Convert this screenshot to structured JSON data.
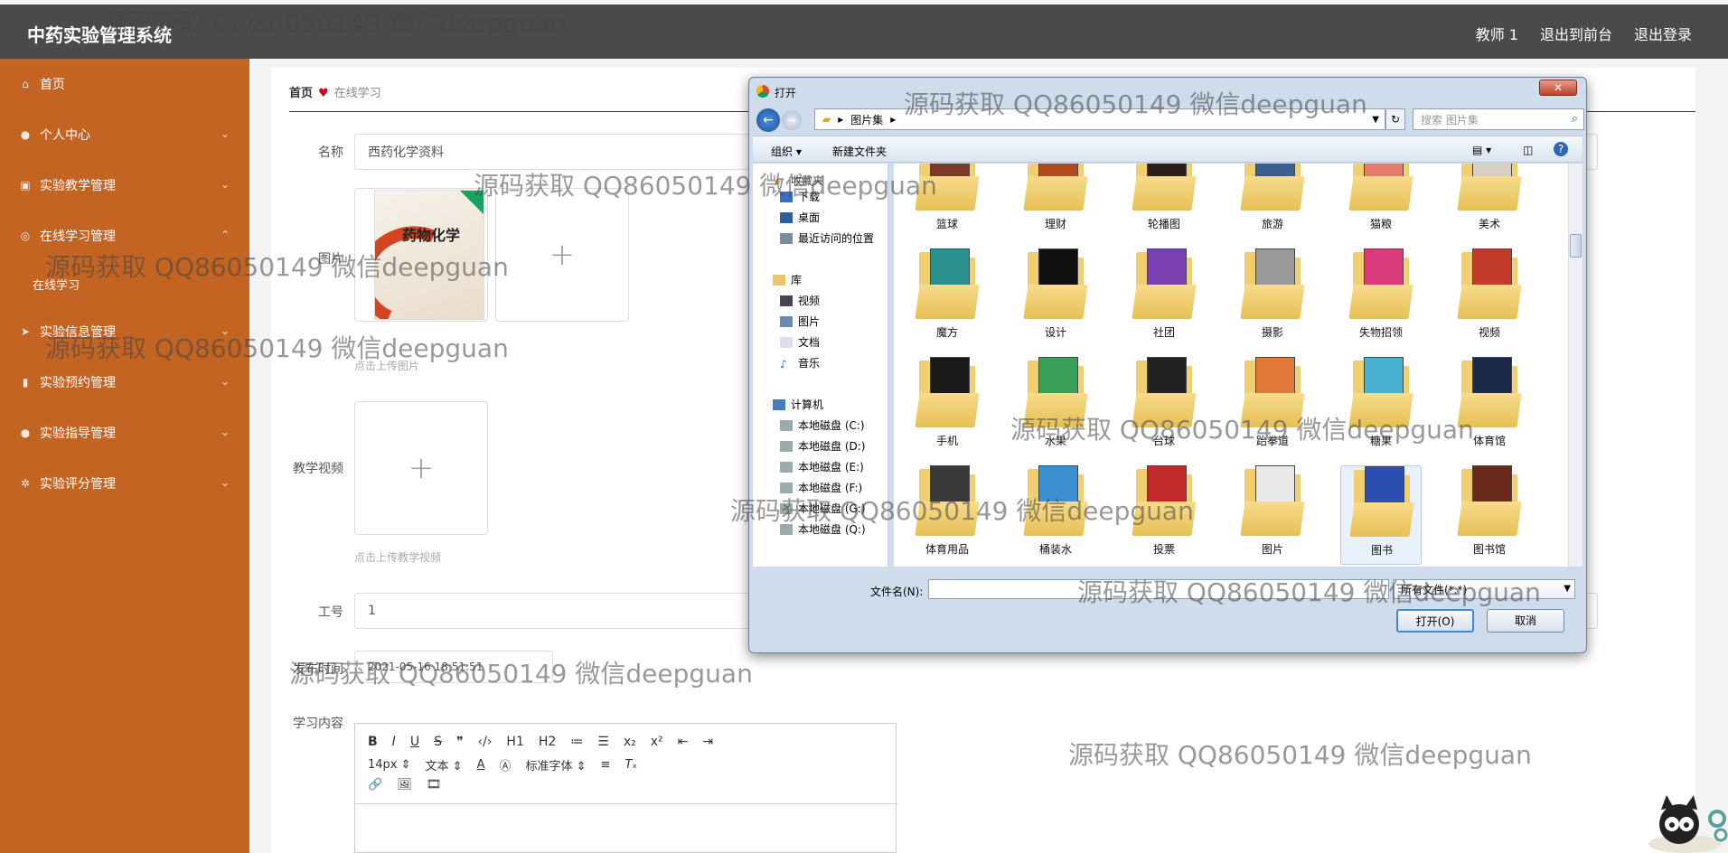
{
  "topbar": {
    "brand": "中药实验管理系统",
    "user": "教师 1",
    "to_frontend": "退出到前台",
    "logout": "退出登录"
  },
  "sidebar": {
    "items": [
      {
        "label": "首页",
        "icon": "home-icon"
      },
      {
        "label": "个人中心",
        "icon": "person-icon"
      },
      {
        "label": "实验教学管理",
        "icon": "clipboard-icon"
      },
      {
        "label": "在线学习管理",
        "icon": "globe-icon"
      },
      {
        "label": "实验信息管理",
        "icon": "send-icon"
      },
      {
        "label": "实验预约管理",
        "icon": "bar-chart-icon"
      },
      {
        "label": "实验指导管理",
        "icon": "person-icon"
      },
      {
        "label": "实验评分管理",
        "icon": "settings-icon"
      }
    ],
    "sub_item": "在线学习"
  },
  "breadcrumb": {
    "home": "首页",
    "current": "在线学习"
  },
  "form": {
    "name_label": "名称",
    "name_value": "西药化学资料",
    "image_label": "图片",
    "image_hint": "点击上传图片",
    "book_title": "药物化学",
    "video_label": "教学视频",
    "video_hint": "点击上传教学视频",
    "job_label": "工号",
    "job_value": "1",
    "time_label": "发布时间",
    "time_value": "2021-05-16 18:51:51",
    "content_label": "学习内容"
  },
  "editor": {
    "row1": [
      "B",
      "I",
      "U",
      "S",
      "❞",
      "‹/›",
      "H1",
      "H2",
      "≔",
      "☰",
      "x₂",
      "x²",
      "⇤",
      "⇥"
    ],
    "font_size": "14px",
    "text_style": "文本",
    "font_family": "标准字体",
    "row3": [
      "🔗",
      "🖼",
      "🎞"
    ]
  },
  "dialog": {
    "title": "打开",
    "close": "✕",
    "path": "图片集",
    "search_placeholder": "搜索 图片集",
    "organize": "组织 ▾",
    "new_folder": "新建文件夹",
    "nav_favorites": "收藏夹",
    "nav": [
      {
        "label": "下载"
      },
      {
        "label": "桌面"
      },
      {
        "label": "最近访问的位置"
      },
      {
        "label": "库"
      },
      {
        "label": "视频"
      },
      {
        "label": "图片"
      },
      {
        "label": "文档"
      },
      {
        "label": "音乐"
      },
      {
        "label": "计算机"
      },
      {
        "label": "本地磁盘 (C:)"
      },
      {
        "label": "本地磁盘 (D:)"
      },
      {
        "label": "本地磁盘 (E:)"
      },
      {
        "label": "本地磁盘 (F:)"
      },
      {
        "label": "本地磁盘 (G:)"
      },
      {
        "label": "本地磁盘 (Q:)"
      }
    ],
    "folders": [
      {
        "name": "篮球",
        "color": "#7a3b2a"
      },
      {
        "name": "理财",
        "color": "#b04a20"
      },
      {
        "name": "轮播图",
        "color": "#2a2018"
      },
      {
        "name": "旅游",
        "color": "#3a5f8f"
      },
      {
        "name": "猫粮",
        "color": "#e87a6a"
      },
      {
        "name": "美术",
        "color": "#d8d0c4"
      },
      {
        "name": "魔方",
        "color": "#2a8f8f"
      },
      {
        "name": "设计",
        "color": "#111111"
      },
      {
        "name": "社团",
        "color": "#7a3fb0"
      },
      {
        "name": "摄影",
        "color": "#9a9a9a"
      },
      {
        "name": "失物招领",
        "color": "#d83a7a"
      },
      {
        "name": "视频",
        "color": "#c23a2a"
      },
      {
        "name": "手机",
        "color": "#1a1a1a"
      },
      {
        "name": "水果",
        "color": "#3aa05a"
      },
      {
        "name": "台球",
        "color": "#222222"
      },
      {
        "name": "跆拳道",
        "color": "#e0783a"
      },
      {
        "name": "糖果",
        "color": "#4ab0d0"
      },
      {
        "name": "体育馆",
        "color": "#1a2a4a"
      },
      {
        "name": "体育用品",
        "color": "#3a3a3a"
      },
      {
        "name": "桶装水",
        "color": "#3a8fd0"
      },
      {
        "name": "投票",
        "color": "#c02a2a"
      },
      {
        "name": "图片",
        "color": "#e8e8e8"
      },
      {
        "name": "图书",
        "color": "#2a4fb0"
      },
      {
        "name": "图书馆",
        "color": "#6a2a1a"
      }
    ],
    "filename_label": "文件名(N):",
    "filetype": "所有文件(*.*)",
    "open_button": "打开(O)",
    "cancel_button": "取消"
  },
  "watermark": "源码获取 QQ86050149 微信deepguan"
}
